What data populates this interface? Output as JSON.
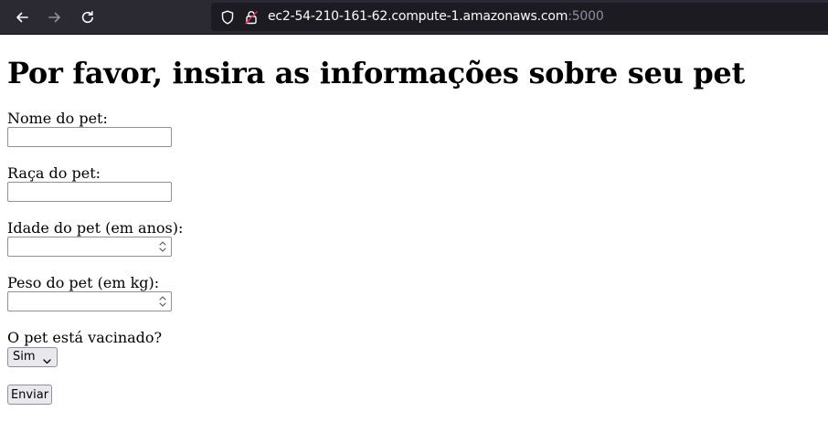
{
  "browser": {
    "url_host": "ec2-54-210-161-62.compute-1.amazonaws.com",
    "url_port": ":5000",
    "icons": [
      "back-arrow-icon",
      "forward-arrow-icon",
      "reload-icon",
      "shield-icon",
      "insecure-lock-icon"
    ]
  },
  "page": {
    "title": "Por favor, insira as informações sobre seu pet",
    "form": {
      "name_label": "Nome do pet:",
      "name_value": "",
      "breed_label": "Raça do pet:",
      "breed_value": "",
      "age_label": "Idade do pet (em anos):",
      "age_value": "",
      "weight_label": "Peso do pet (em kg):",
      "weight_value": "",
      "vaccinated_label": "O pet está vacinado?",
      "vaccinated_selected": "Sim",
      "submit_label": "Enviar"
    }
  },
  "colors": {
    "toolbar_bg": "#2b2a33",
    "urlbar_bg": "#1c1b22",
    "url_text": "#fbfbfe",
    "url_port": "#8f8f9d",
    "input_border": "#8f8f9d",
    "button_bg": "#e9e9ed"
  }
}
